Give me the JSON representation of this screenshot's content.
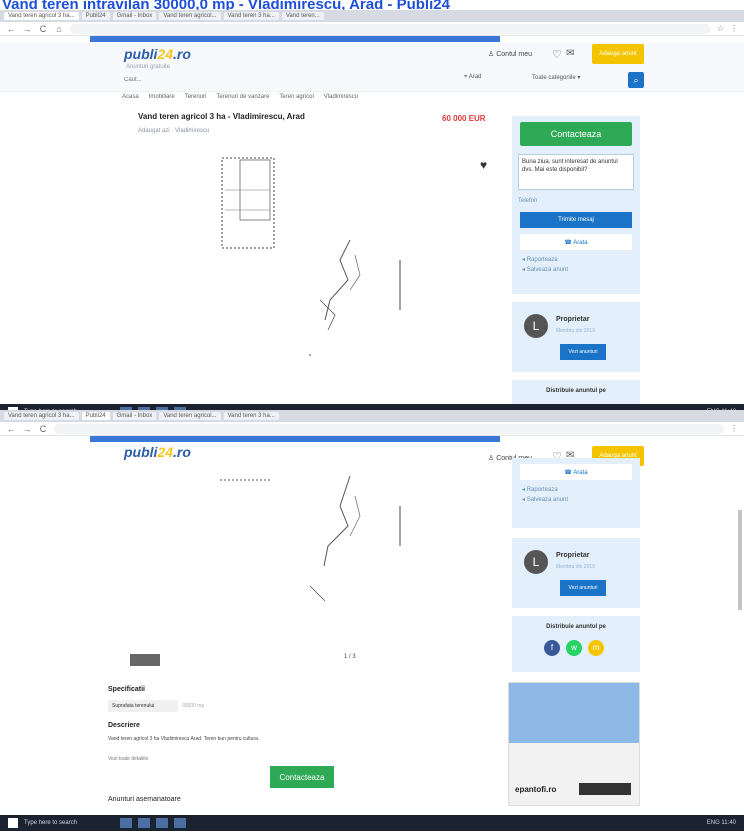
{
  "document_title": "Vand teren intravilan 30000,0 mp - Vladimirescu, Arad - Publi24",
  "browser": {
    "tabs": [
      "Vand teren agricol 3 ha...",
      "Publi24",
      "Gmail - Inbox",
      "Vand teren agricol...",
      "Vand teren 3 ha...",
      "Vand teren..."
    ],
    "back": "←",
    "forward": "→",
    "reload": "C",
    "home": "⌂"
  },
  "site": {
    "logo_left": "publi",
    "logo_mid": "24",
    "logo_right": ".ro",
    "tagline": "Anunturi gratuite",
    "search_placeholder": "Caut...",
    "user_label": "Contul meu",
    "add_ad": "Adauga anunt",
    "location": "Arad",
    "category": "Toate categoriile",
    "search_icon": "search-icon",
    "nav": [
      "Acasa",
      "Imobiliare",
      "Terenuri",
      "Terenuri de vanzare",
      "Teren agricol",
      "Vladimirescu"
    ]
  },
  "listing": {
    "title": "Vand teren agricol 3 ha - Vladimirescu, Arad",
    "price": "60 000 EUR",
    "meta": "Adaugat azi · Vladimirescu"
  },
  "sidebar": {
    "contact": "Contacteaza",
    "message": "Buna ziua, sunt interesat de anuntul dvs. Mai este disponibil?",
    "phone_placeholder": "Telefon",
    "send": "Trimite mesaj",
    "show_phone": "Arata",
    "links": [
      "Raporteaza",
      "Salveaza anunt"
    ]
  },
  "seller": {
    "initial": "L",
    "name": "Proprietar",
    "sub": "Membru din 2019",
    "view": "Vezi anunturi"
  },
  "share": {
    "title": "Distribuie anuntul pe",
    "networks": [
      {
        "label": "f",
        "color": "#3b5998"
      },
      {
        "label": "w",
        "color": "#25d366"
      },
      {
        "label": "m",
        "color": "#f5c400"
      }
    ]
  },
  "lower": {
    "specs_heading": "Specificatii",
    "spec_key": "Suprafata terenului",
    "spec_val": "30000 mp",
    "desc_heading": "Descriere",
    "desc_text": "Vand teren agricol 3 ha Vladimirescu Arad. Teren bun pentru cultura.",
    "desc_link": "Vezi toate detaliile",
    "contact": "Contacteaza",
    "similar": "Anunturi asemanatoare",
    "counter": "1 / 3",
    "banner_logo": "epantofi.ro"
  },
  "taskbar": {
    "search": "Type here to search",
    "tray": "ENG 11:40"
  }
}
